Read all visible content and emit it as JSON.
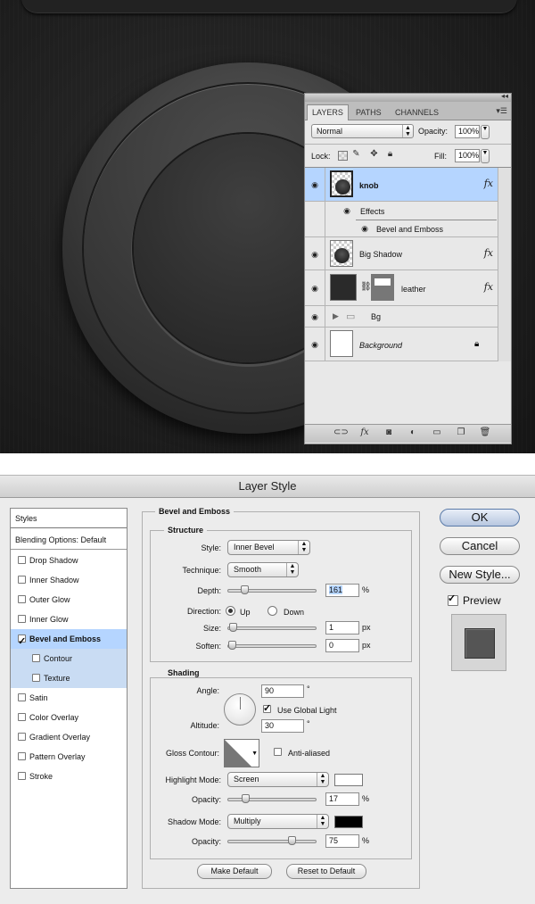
{
  "layers_panel": {
    "tabs": [
      "LAYERS",
      "PATHS",
      "CHANNELS"
    ],
    "blend_mode": "Normal",
    "opacity_label": "Opacity:",
    "opacity_value": "100%",
    "lock_label": "Lock:",
    "fill_label": "Fill:",
    "fill_value": "100%",
    "layers": [
      {
        "name": "knob"
      },
      {
        "name": "Effects"
      },
      {
        "name": "Bevel and Emboss"
      },
      {
        "name": "Big Shadow"
      },
      {
        "name": "leather"
      },
      {
        "name": "Bg"
      },
      {
        "name": "Background"
      }
    ],
    "fx_symbol": "fx"
  },
  "dialog": {
    "title": "Layer Style",
    "styles_header": "Styles",
    "styles": [
      {
        "label": "Blending Options: Default"
      },
      {
        "label": "Drop Shadow",
        "checked": false
      },
      {
        "label": "Inner Shadow",
        "checked": false
      },
      {
        "label": "Outer Glow",
        "checked": false
      },
      {
        "label": "Inner Glow",
        "checked": false
      },
      {
        "label": "Bevel and Emboss",
        "checked": true
      },
      {
        "label": "Contour",
        "checked": false
      },
      {
        "label": "Texture",
        "checked": false
      },
      {
        "label": "Satin",
        "checked": false
      },
      {
        "label": "Color Overlay",
        "checked": false
      },
      {
        "label": "Gradient Overlay",
        "checked": false
      },
      {
        "label": "Pattern Overlay",
        "checked": false
      },
      {
        "label": "Stroke",
        "checked": false
      }
    ],
    "section_title": "Bevel and Emboss",
    "structure": {
      "title": "Structure",
      "style_label": "Style:",
      "style_value": "Inner Bevel",
      "technique_label": "Technique:",
      "technique_value": "Smooth",
      "depth_label": "Depth:",
      "depth_value": "161",
      "depth_unit": "%",
      "direction_label": "Direction:",
      "direction_up": "Up",
      "direction_down": "Down",
      "size_label": "Size:",
      "size_value": "1",
      "size_unit": "px",
      "soften_label": "Soften:",
      "soften_value": "0",
      "soften_unit": "px"
    },
    "shading": {
      "title": "Shading",
      "angle_label": "Angle:",
      "angle_value": "90",
      "degree": "°",
      "global_light_label": "Use Global Light",
      "altitude_label": "Altitude:",
      "altitude_value": "30",
      "gloss_contour_label": "Gloss Contour:",
      "anti_aliased_label": "Anti-aliased",
      "highlight_mode_label": "Highlight Mode:",
      "highlight_mode_value": "Screen",
      "highlight_color": "#ffffff",
      "highlight_opacity_label": "Opacity:",
      "highlight_opacity_value": "17",
      "shadow_mode_label": "Shadow Mode:",
      "shadow_mode_value": "Multiply",
      "shadow_color": "#000000",
      "shadow_opacity_label": "Opacity:",
      "shadow_opacity_value": "75",
      "percent": "%"
    },
    "buttons": {
      "make_default": "Make Default",
      "reset_default": "Reset to Default",
      "ok": "OK",
      "cancel": "Cancel",
      "new_style": "New Style...",
      "preview": "Preview"
    },
    "slider_levels": {
      "depth": 0.16,
      "size": 0.01,
      "soften": 0.0,
      "highlight_opacity": 0.17,
      "shadow_opacity": 0.75
    }
  }
}
